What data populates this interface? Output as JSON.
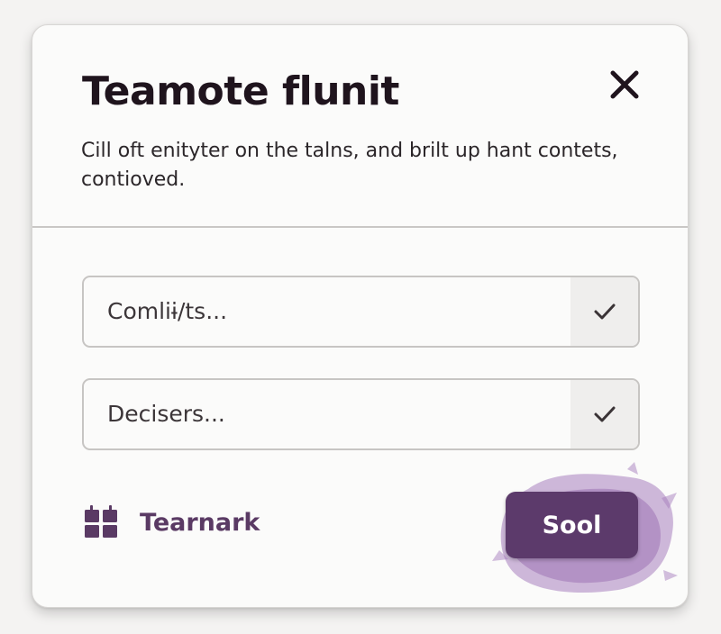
{
  "dialog": {
    "title": "Teamote flunit",
    "description": "Cill oft enityter on the talns, and brilt up hant contets, contioved.",
    "close_icon": "close-icon"
  },
  "fields": [
    {
      "value": "Comliɨ/ts...",
      "icon": "checkmark-icon"
    },
    {
      "value": "Decisers...",
      "icon": "checkmark-icon"
    }
  ],
  "footer": {
    "brand_label": "Tearnark",
    "brand_icon": "grid-icon",
    "submit_label": "Sool"
  },
  "colors": {
    "accent": "#5c3a6b",
    "brand_text": "#5a3a64",
    "splash": "#a77fbd",
    "title": "#1f141d"
  }
}
